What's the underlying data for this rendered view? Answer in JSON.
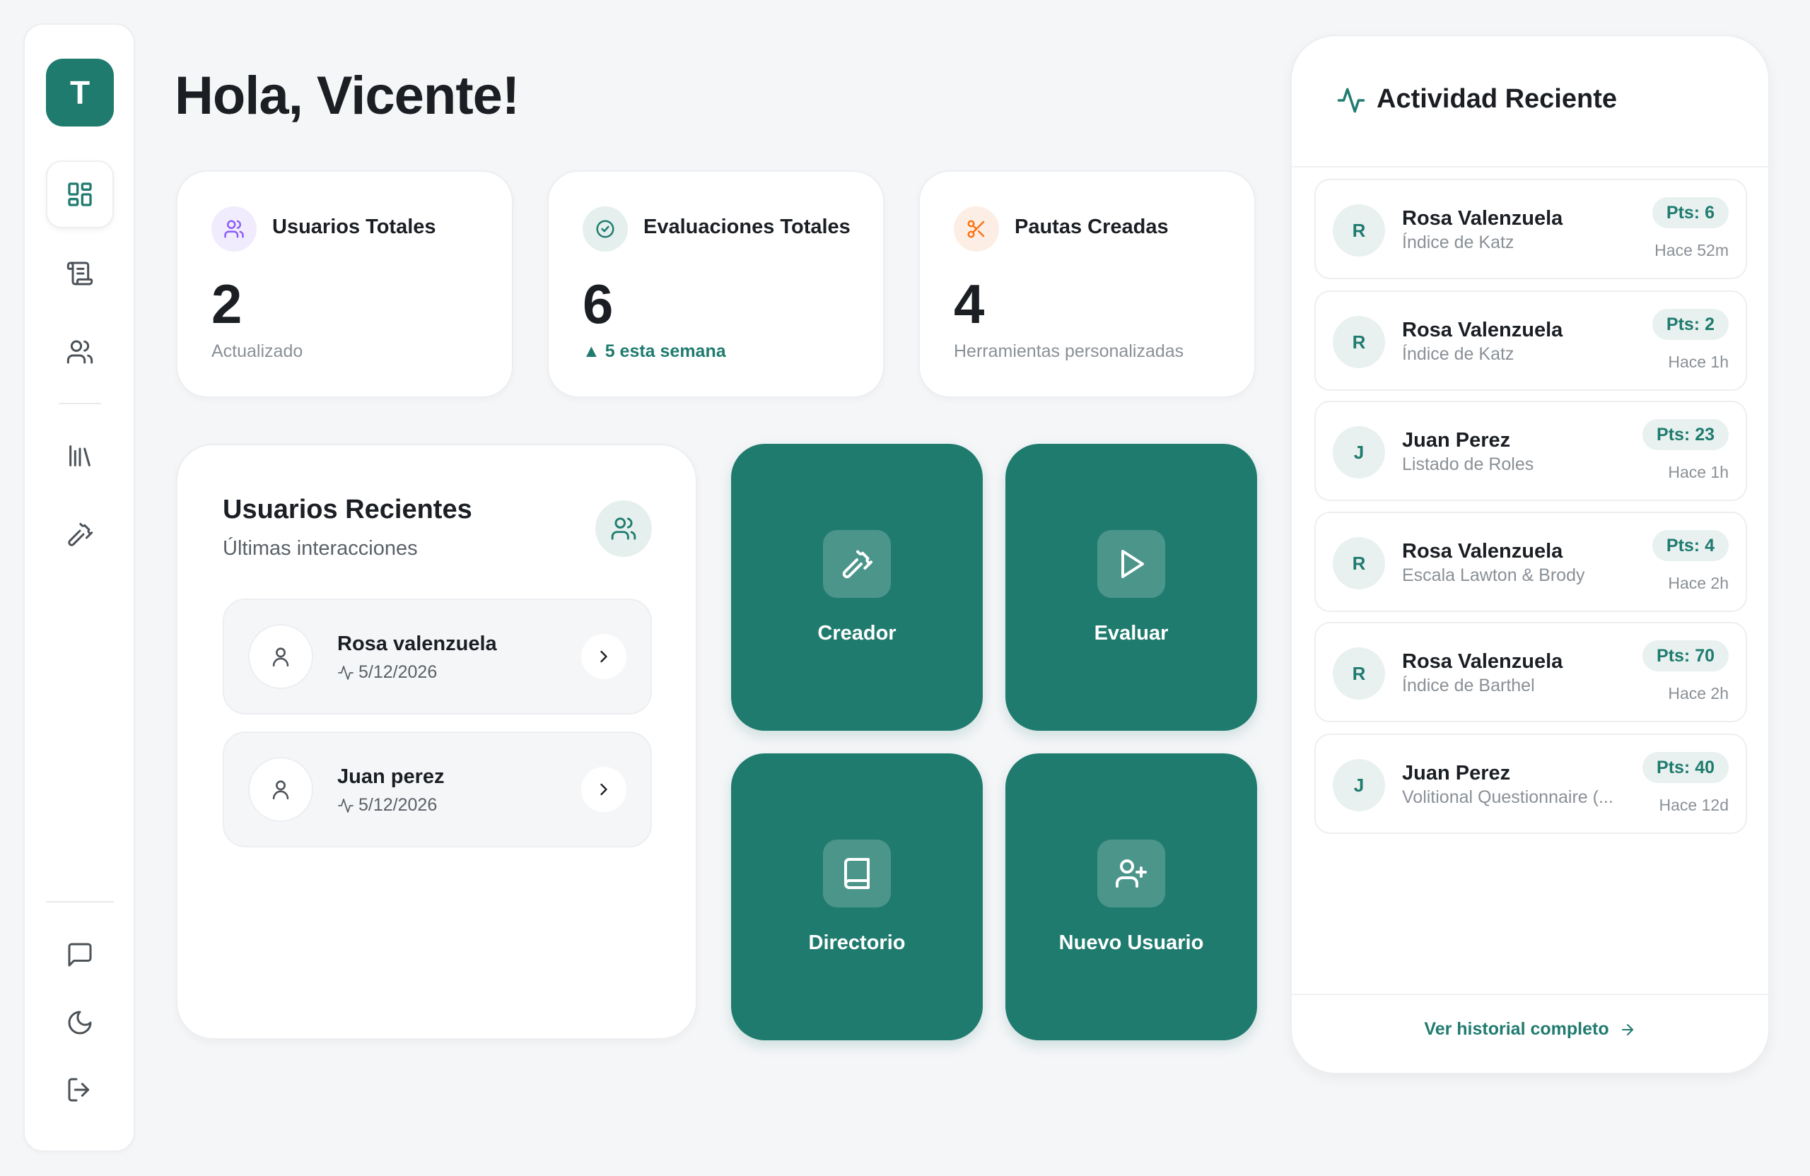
{
  "app": {
    "logo_letter": "T"
  },
  "greeting": "Hola, Vicente!",
  "stats": [
    {
      "label": "Usuarios Totales",
      "value": "2",
      "sub": "Actualizado",
      "icon": "users-icon",
      "color": "#8b5cf6"
    },
    {
      "label": "Evaluaciones Totales",
      "value": "6",
      "sub": "▲ 5 esta semana",
      "icon": "check-circle-icon",
      "color": "#207b6f"
    },
    {
      "label": "Pautas Creadas",
      "value": "4",
      "sub": "Herramientas personalizadas",
      "icon": "scissors-icon",
      "color": "#f97316"
    }
  ],
  "recent_users": {
    "title": "Usuarios Recientes",
    "subtitle": "Últimas interacciones",
    "items": [
      {
        "name": "Rosa valenzuela",
        "date": "5/12/2026"
      },
      {
        "name": "Juan perez",
        "date": "5/12/2026"
      }
    ]
  },
  "actions": [
    {
      "label": "Creador",
      "icon": "hammer-icon"
    },
    {
      "label": "Evaluar",
      "icon": "play-icon"
    },
    {
      "label": "Directorio",
      "icon": "book-icon"
    },
    {
      "label": "Nuevo Usuario",
      "icon": "user-plus-icon"
    }
  ],
  "activity": {
    "title": "Actividad Reciente",
    "items": [
      {
        "initial": "R",
        "name": "Rosa Valenzuela",
        "desc": "Índice de Katz",
        "pts": "Pts: 6",
        "time": "Hace 52m"
      },
      {
        "initial": "R",
        "name": "Rosa Valenzuela",
        "desc": "Índice de Katz",
        "pts": "Pts: 2",
        "time": "Hace 1h"
      },
      {
        "initial": "J",
        "name": "Juan Perez",
        "desc": "Listado de Roles",
        "pts": "Pts: 23",
        "time": "Hace 1h"
      },
      {
        "initial": "R",
        "name": "Rosa Valenzuela",
        "desc": "Escala Lawton & Brody",
        "pts": "Pts: 4",
        "time": "Hace 2h"
      },
      {
        "initial": "R",
        "name": "Rosa Valenzuela",
        "desc": "Índice de Barthel",
        "pts": "Pts: 70",
        "time": "Hace 2h"
      },
      {
        "initial": "J",
        "name": "Juan Perez",
        "desc": "Volitional Questionnaire (...",
        "pts": "Pts: 40",
        "time": "Hace 12d"
      }
    ],
    "footer_link": "Ver historial completo"
  },
  "colors": {
    "accent": "#207b6f",
    "background": "#f5f6f8"
  }
}
